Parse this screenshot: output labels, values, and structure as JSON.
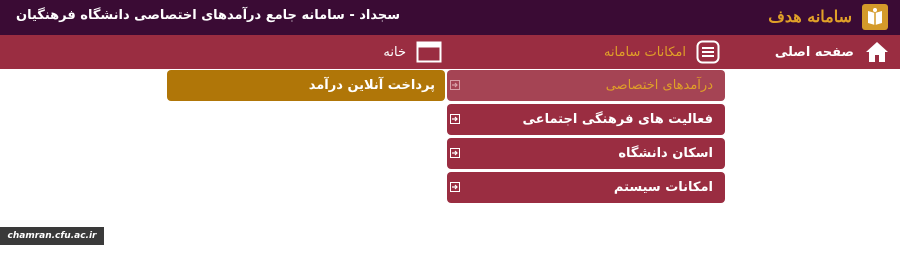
{
  "header": {
    "brand": "سامانه هدف",
    "app_title": "سجداد - سامانه جامع درآمدهای اختصاصی دانشگاه فرهنگیان",
    "logo_icon": "book-logo-icon"
  },
  "nav": {
    "main_page": "صفحه اصلی",
    "system_facilities": "امکانات سامانه",
    "home": "خانه"
  },
  "menu": {
    "items": [
      {
        "label": "درآمدهای اختصاصی"
      },
      {
        "label": "فعالیت های فرهنگی اجتماعی"
      },
      {
        "label": "اسکان دانشگاه"
      },
      {
        "label": "امکانات سیستم"
      }
    ],
    "submenu": {
      "label": "پرداخت آنلاین درآمد"
    }
  },
  "footer": {
    "badge": "chamran.cfu.ac.ir"
  },
  "colors": {
    "header_bg": "#3a0b34",
    "nav_bg": "#9a2d41",
    "accent": "#e0a028",
    "submenu_bg": "#b07608"
  }
}
